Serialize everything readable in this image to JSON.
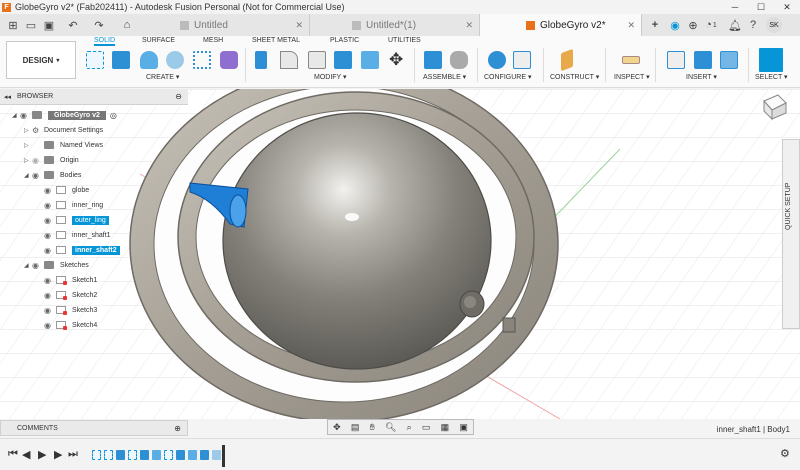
{
  "window": {
    "title": "GlobeGyro v2* (Fab202411) - Autodesk Fusion Personal (Not for Commercial Use)",
    "controls": [
      "─",
      "☐",
      "✕"
    ]
  },
  "tabs": [
    {
      "label": "Untitled",
      "active": false
    },
    {
      "label": "Untitled*(1)",
      "active": false
    },
    {
      "label": "GlobeGyro v2*",
      "active": true
    }
  ],
  "tabbar_right": {
    "notifications_count": "1",
    "user_initials": "SK"
  },
  "workspace": {
    "label": "DESIGN"
  },
  "ribbon_tabs": [
    "SOLID",
    "SURFACE",
    "MESH",
    "SHEET METAL",
    "PLASTIC",
    "UTILITIES"
  ],
  "ribbon_groups": [
    "CREATE ▾",
    "MODIFY ▾",
    "ASSEMBLE ▾",
    "CONFIGURE ▾",
    "CONSTRUCT ▾",
    "INSPECT ▾",
    "INSERT ▾",
    "SELECT ▾"
  ],
  "browser": {
    "title": "BROWSER",
    "root": "GlobeGyro v2",
    "items": [
      {
        "label": "Document Settings"
      },
      {
        "label": "Named Views"
      },
      {
        "label": "Origin"
      },
      {
        "label": "Bodies"
      },
      {
        "label": "globe"
      },
      {
        "label": "inner_ring"
      },
      {
        "label": "outer_ling"
      },
      {
        "label": "inner_shaft1"
      },
      {
        "label": "inner_shaft2"
      },
      {
        "label": "Sketches"
      },
      {
        "label": "Sketch1"
      },
      {
        "label": "Sketch2"
      },
      {
        "label": "Sketch3"
      },
      {
        "label": "Sketch4"
      }
    ]
  },
  "quick_setup": "QUICK SETUP",
  "comments": "COMMENTS",
  "status": "inner_shaft1 | Body1",
  "colors": {
    "accent": "#0696d7",
    "selected": "#0696d7",
    "ring": "#a49e94",
    "globe": "#8a8780"
  }
}
